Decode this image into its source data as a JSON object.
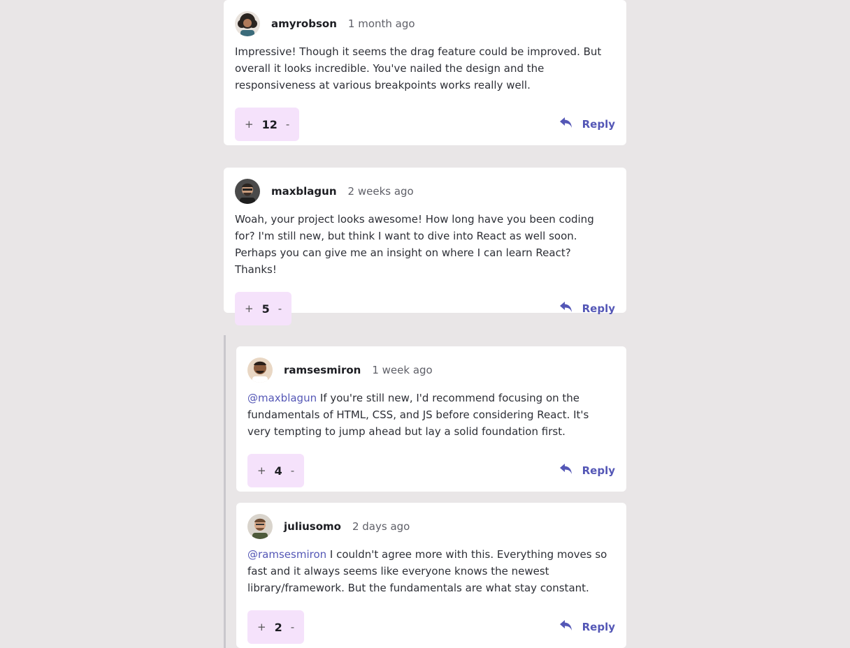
{
  "reply_label": "Reply",
  "colors": {
    "accent": "#5457b6",
    "vote_bg": "#f5e2fb",
    "page_bg": "#e9e6e7"
  },
  "comments": [
    {
      "username": "amyrobson",
      "time": "1 month ago",
      "mention": "",
      "text": "Impressive! Though it seems the drag feature could be improved. But overall it looks incredible. You've nailed the design and the responsiveness at various breakpoints works really well.",
      "plus": "+",
      "score": "12",
      "minus": "-"
    },
    {
      "username": "maxblagun",
      "time": "2 weeks ago",
      "mention": "",
      "text": "Woah, your project looks awesome! How long have you been coding for? I'm still new, but think I want to dive into React as well soon. Perhaps you can give me an insight on where I can learn React? Thanks!",
      "plus": "+",
      "score": "5",
      "minus": "-"
    },
    {
      "username": "ramsesmiron",
      "time": "1 week ago",
      "mention": "@maxblagun",
      "text": "If you're still new, I'd recommend focusing on the fundamentals of HTML, CSS, and JS before considering React. It's very tempting to jump ahead but lay a solid foundation first.",
      "plus": "+",
      "score": "4",
      "minus": "-"
    },
    {
      "username": "juliusomo",
      "time": "2 days ago",
      "mention": "@ramsesmiron",
      "text": "I couldn't agree more with this. Everything moves so fast and it always seems like everyone knows the newest library/framework. But the fundamentals are what stay constant.",
      "plus": "+",
      "score": "2",
      "minus": "-"
    }
  ]
}
